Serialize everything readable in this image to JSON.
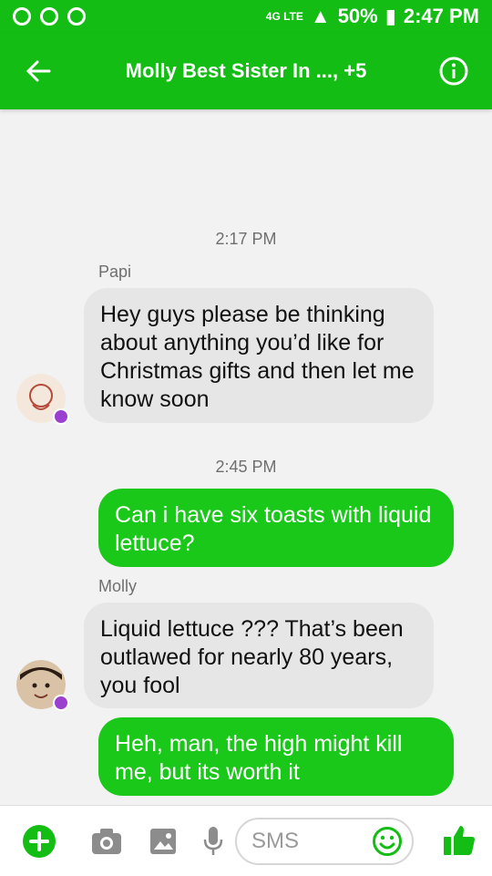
{
  "status": {
    "battery": "50%",
    "time": "2:47 PM",
    "network": "4G LTE"
  },
  "header": {
    "title": "Molly Best Sister In ..., +5"
  },
  "messages": [
    {
      "type": "timestamp",
      "text": "2:17 PM"
    },
    {
      "type": "sender",
      "text": "Papi"
    },
    {
      "type": "in",
      "text": "Hey guys please be thinking about anything you’d like for Christmas gifts and then let me know soon"
    },
    {
      "type": "timestamp",
      "text": "2:45 PM"
    },
    {
      "type": "out",
      "text": "Can i have six toasts with liquid lettuce?"
    },
    {
      "type": "sender",
      "text": "Molly"
    },
    {
      "type": "in",
      "text": "Liquid lettuce ??? That’s been outlawed for nearly 80 years, you fool"
    },
    {
      "type": "out",
      "text": "Heh, man, the high might kill me, but its worth it"
    }
  ],
  "composer": {
    "placeholder": "SMS"
  },
  "colors": {
    "brand": "#13bd13",
    "outgoing": "#1ac81a",
    "incoming": "#e6e6e6",
    "badge": "#9b3fd1"
  },
  "icons": {
    "back": "arrow-left-icon",
    "info": "info-icon",
    "plus": "plus-icon",
    "camera": "camera-icon",
    "image": "image-icon",
    "mic": "mic-icon",
    "emoji": "emoji-icon",
    "like": "thumbs-up-icon"
  }
}
